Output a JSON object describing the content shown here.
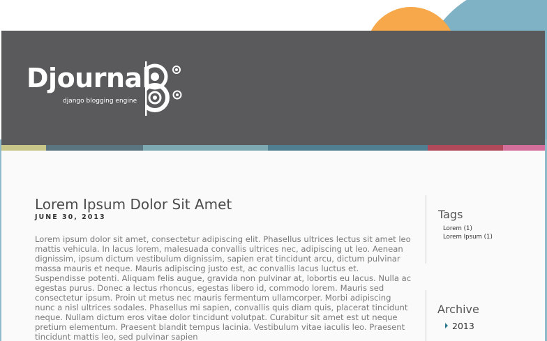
{
  "brand": {
    "name": "Djournal",
    "tagline": "django blogging engine"
  },
  "colors": {
    "header_bg": "#5a5a5c",
    "strip": [
      "#c9c68a",
      "#5a7480",
      "#7daab2",
      "#4f7f90",
      "#b04a5a",
      "#d46f9c"
    ]
  },
  "post": {
    "title": "Lorem Ipsum Dolor Sit Amet",
    "date": "JUNE 30, 2013",
    "body": "Lorem ipsum dolor sit amet, consectetur adipiscing elit. Phasellus ultrices lectus sit amet leo mattis vehicula. In lacus lorem, malesuada convallis ultrices nec, adipiscing ut leo. Aenean dignissim, ipsum dictum vestibulum dignissim, sapien erat tincidunt arcu, dictum pulvinar massa mauris et neque. Mauris adipiscing justo est, ac convallis lacus luctus et. Suspendisse potenti. Aliquam felis augue, gravida non pulvinar at, lobortis eu lacus. Nulla ac egestas purus. Donec a lectus rhoncus, egestas libero id, commodo lorem. Mauris sed consectetur ipsum. Proin ut metus nec mauris fermentum ullamcorper. Morbi adipiscing nunc a nisl ultrices sodales. Phasellus mi sapien, convallis quis diam quis, placerat tincidunt neque. Nullam dictum eros vitae dolor tincidunt volutpat. Curabitur sit amet est ut neque pretium elementum. Praesent blandit tempus lacinia. Vestibulum vitae iaculis leo. Praesent tincidunt mattis leo, sed pulvinar sapien"
  },
  "sidebar": {
    "tags": {
      "title": "Tags",
      "items": [
        "Lorem (1)",
        "Lorem Ipsum (1)"
      ]
    },
    "archive": {
      "title": "Archive",
      "items": [
        "2013"
      ]
    }
  }
}
